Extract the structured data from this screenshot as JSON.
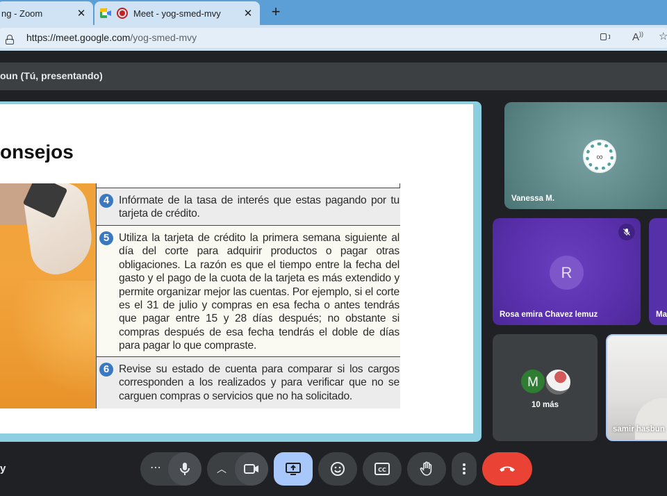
{
  "browser": {
    "tabs": [
      {
        "title": "ng - Zoom",
        "active": false
      },
      {
        "title": "Meet - yog-smed-mvy",
        "active": true
      }
    ],
    "url_host": "https://meet.google.com",
    "url_path": "/yog-smed-mvy"
  },
  "meet": {
    "presenter_label": "oun (Tú, presentando)",
    "meeting_code_fragment": "y"
  },
  "slide": {
    "title": "onsejos",
    "tips": [
      {
        "num": "4",
        "text": "Infórmate de la tasa de interés que estas pagando por tu tarjeta de crédito."
      },
      {
        "num": "5",
        "text": "Utiliza la tarjeta de crédito la primera semana siguiente al día del corte para adquirir productos o pagar otras obligaciones. La razón es que el tiempo entre la fecha del gasto y el pago de la cuota de la tarjeta es más extendido y permite organizar mejor las cuentas. Por ejemplo, si el corte es el 31 de julio y compras en esa fecha o antes tendrás que pagar entre 15 y 28 días después; no obstante si compras después de esa fecha tendrás el doble de días para pagar lo que compraste."
      },
      {
        "num": "6",
        "text": "Revise su estado de cuenta para comparar si los cargos corresponden a los realizados y para verificar que no se carguen compras o servicios que no ha solicitado."
      }
    ]
  },
  "participants": {
    "vanessa": {
      "name": "Vanessa M."
    },
    "rosa": {
      "name": "Rosa emira Chavez lemuz",
      "initial": "R",
      "muted": true
    },
    "partial": {
      "name": "Ma"
    },
    "more": {
      "initial": "M",
      "label": "10 más"
    },
    "samir": {
      "name": "samir hasbun"
    }
  },
  "colors": {
    "accent": "#a8c7fa",
    "leave": "#ea4335",
    "control_bg": "#3c4043",
    "tile_purple": "#5a30ad",
    "tile_teal": "#5e8888",
    "slide_border": "#8ccfe0"
  }
}
